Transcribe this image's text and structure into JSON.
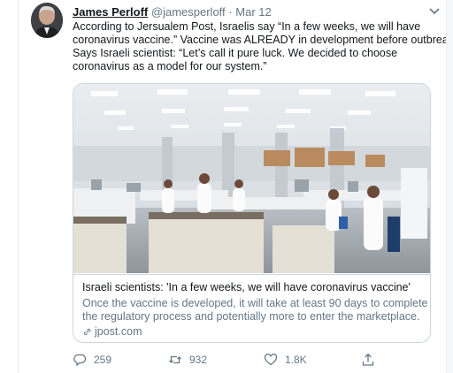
{
  "tweet": {
    "author_name": "James Perloff",
    "handle": "@jamesperloff",
    "separator": "·",
    "date": "Mar 12",
    "text_lines": [
      "According to Jersualem Post, Israelis say “In a few weeks, we will have",
      "coronavirus vaccine.” Vaccine was ALREADY in development before outbreak.",
      "Says Israeli scientist: “Let’s call it pure luck. We decided to choose",
      "coronavirus as a model for our system.”"
    ]
  },
  "card": {
    "title": "Israeli scientists: 'In a few weeks, we will have coronavirus vaccine'",
    "description_lines": [
      "Once the vaccine is developed, it will take at least 90 days to complete",
      "the regulatory process and potentially more to enter the marketplace."
    ],
    "domain": "jpost.com"
  },
  "actions": {
    "replies": "259",
    "retweets": "932",
    "likes": "1.8K"
  },
  "colors": {
    "text": "#14171a",
    "secondary": "#657786",
    "border": "#ccd6dd"
  },
  "icons": [
    "chevron-down-icon",
    "reply-icon",
    "retweet-icon",
    "like-icon",
    "share-icon",
    "link-icon"
  ]
}
